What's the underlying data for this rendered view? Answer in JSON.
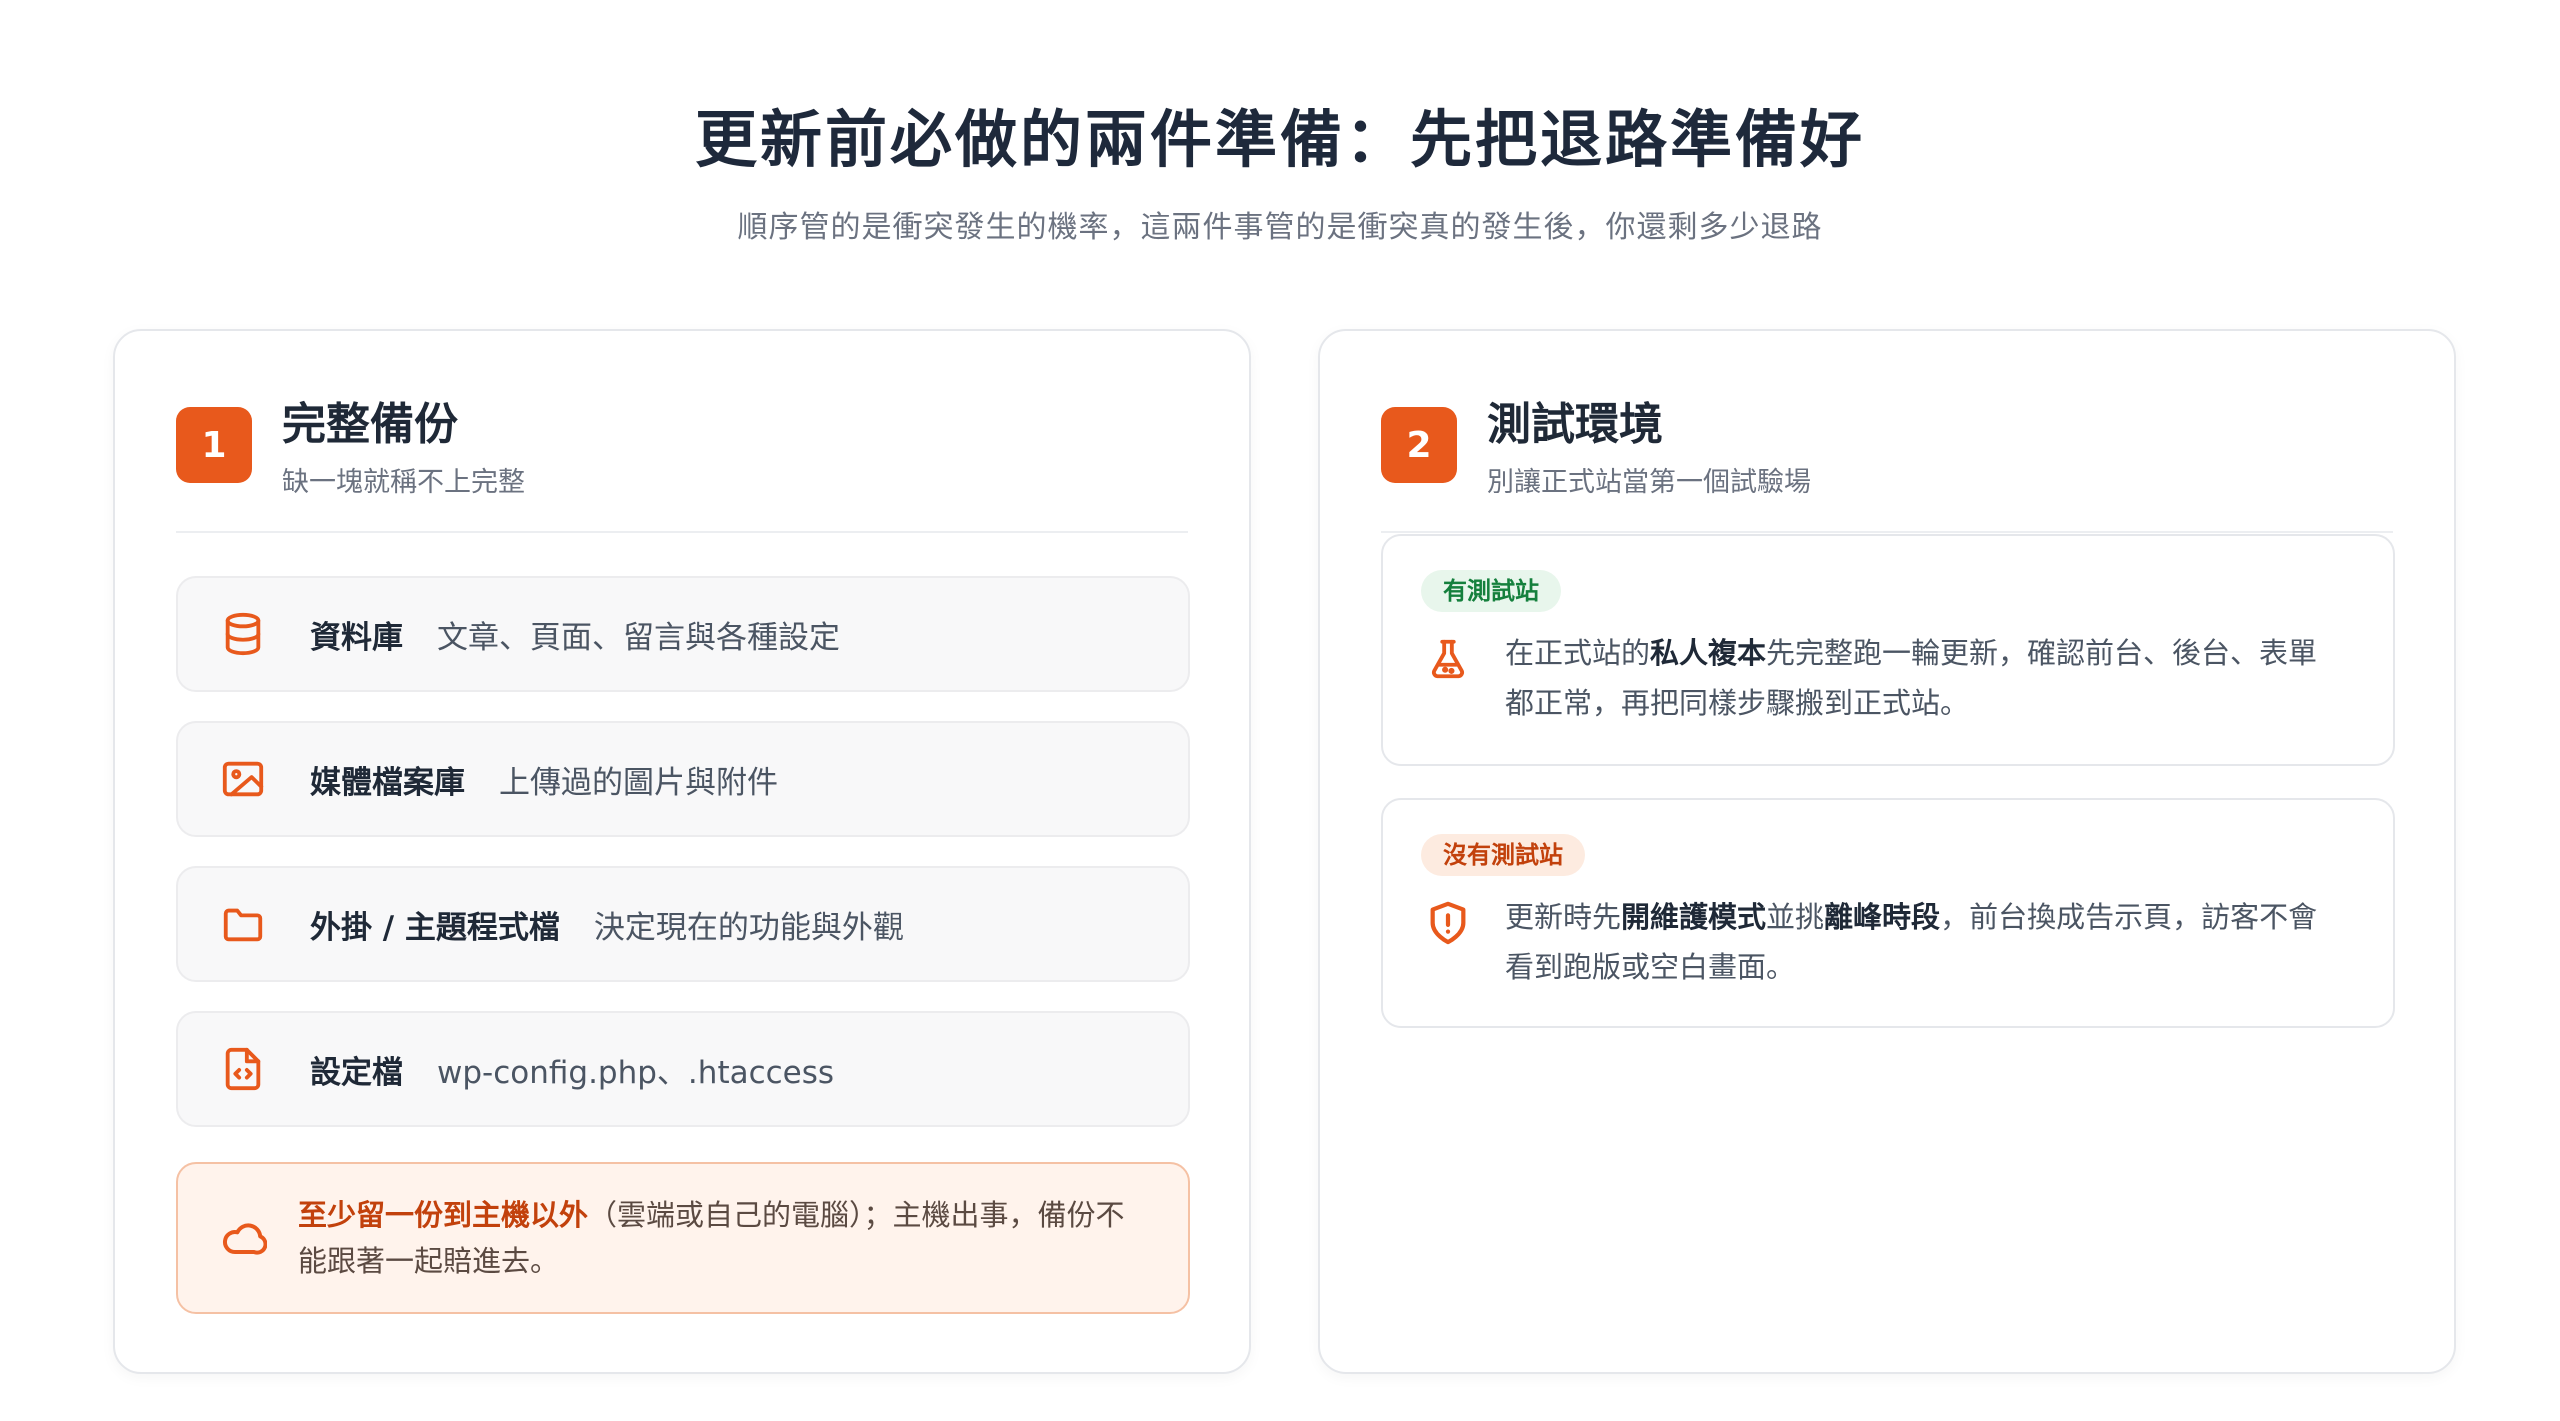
{
  "page": {
    "title": "更新前必做的兩件準備：先把退路準備好",
    "subtitle": "順序管的是衝突發生的機率，這兩件事管的是衝突真的發生後，你還剩多少退路"
  },
  "colors": {
    "accent": "#e8591c",
    "green_tag": "#15803d",
    "orange_tag": "#c2410c"
  },
  "backup": {
    "number": "1",
    "title": "完整備份",
    "subtitle": "缺一塊就稱不上完整",
    "items": [
      {
        "icon": "database-icon",
        "label": "資料庫",
        "desc": "文章、頁面、留言與各種設定"
      },
      {
        "icon": "image-icon",
        "label": "媒體檔案庫",
        "desc": "上傳過的圖片與附件"
      },
      {
        "icon": "folder-icon",
        "label": "外掛 / 主題程式檔",
        "desc": "決定現在的功能與外觀"
      },
      {
        "icon": "code-file-icon",
        "label": "設定檔",
        "desc": "wp-config.php、.htaccess"
      }
    ],
    "note": {
      "icon": "cloud-icon",
      "highlight": "至少留一份到主機以外",
      "rest": "（雲端或自己的電腦）；主機出事，備份不能跟著一起賠進去。"
    }
  },
  "staging": {
    "number": "2",
    "title": "測試環境",
    "subtitle": "別讓正式站當第一個試驗場",
    "scenarios": [
      {
        "tag": "有測試站",
        "icon": "flask-icon",
        "t1": "在正式站的",
        "b1": "私人複本",
        "t2": "先完整跑一輪更新，確認前台、後台、表單都正常，再把同樣步驟搬到正式站。"
      },
      {
        "tag": "沒有測試站",
        "icon": "shield-alert-icon",
        "t1": "更新時先",
        "b1": "開維護模式",
        "t2": "並挑",
        "b2": "離峰時段",
        "t3": "，前台換成告示頁，訪客不會看到跑版或空白畫面。"
      }
    ]
  }
}
